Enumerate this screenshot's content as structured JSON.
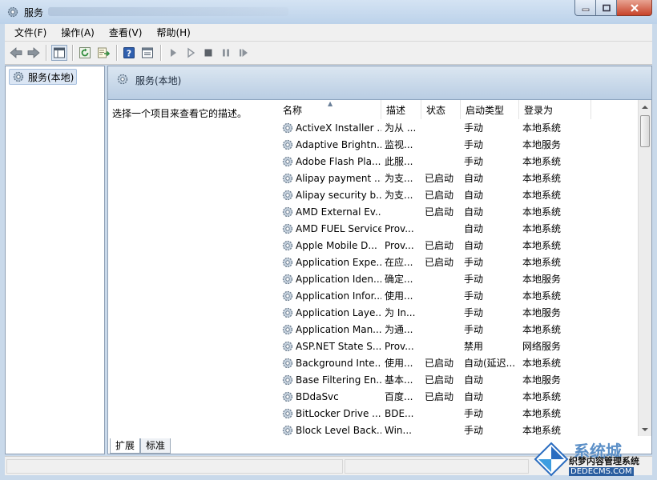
{
  "window": {
    "title": "服务"
  },
  "menu": [
    {
      "label": "文件(F)"
    },
    {
      "label": "操作(A)"
    },
    {
      "label": "查看(V)"
    },
    {
      "label": "帮助(H)"
    }
  ],
  "toolbar_icons": [
    "back-arrow-icon",
    "forward-arrow-icon",
    "show-hide-tree-icon",
    "refresh-icon",
    "export-list-icon",
    "help-icon",
    "properties-icon",
    "start-service-icon",
    "start-service-alt-icon",
    "stop-service-icon",
    "pause-service-icon",
    "restart-service-icon"
  ],
  "tree": {
    "root_label": "服务(本地)"
  },
  "right": {
    "header_title": "服务(本地)",
    "description": "选择一个项目来查看它的描述。"
  },
  "table": {
    "columns": [
      "名称",
      "描述",
      "状态",
      "启动类型",
      "登录为"
    ],
    "rows": [
      {
        "name": "ActiveX Installer ...",
        "desc": "为从 ...",
        "status": "",
        "start": "手动",
        "logon": "本地系统"
      },
      {
        "name": "Adaptive Brightn...",
        "desc": "监视...",
        "status": "",
        "start": "手动",
        "logon": "本地服务"
      },
      {
        "name": "Adobe Flash Pla...",
        "desc": "此服...",
        "status": "",
        "start": "手动",
        "logon": "本地系统"
      },
      {
        "name": "Alipay payment ...",
        "desc": "为支...",
        "status": "已启动",
        "start": "自动",
        "logon": "本地系统"
      },
      {
        "name": "Alipay security b...",
        "desc": "为支...",
        "status": "已启动",
        "start": "自动",
        "logon": "本地系统"
      },
      {
        "name": "AMD External Ev...",
        "desc": "",
        "status": "已启动",
        "start": "自动",
        "logon": "本地系统"
      },
      {
        "name": "AMD FUEL Service",
        "desc": "Prov...",
        "status": "",
        "start": "自动",
        "logon": "本地系统"
      },
      {
        "name": "Apple Mobile D...",
        "desc": "Prov...",
        "status": "已启动",
        "start": "自动",
        "logon": "本地系统"
      },
      {
        "name": "Application Expe...",
        "desc": "在应...",
        "status": "已启动",
        "start": "手动",
        "logon": "本地系统"
      },
      {
        "name": "Application Iden...",
        "desc": "确定...",
        "status": "",
        "start": "手动",
        "logon": "本地服务"
      },
      {
        "name": "Application Infor...",
        "desc": "使用...",
        "status": "",
        "start": "手动",
        "logon": "本地系统"
      },
      {
        "name": "Application Laye...",
        "desc": "为 In...",
        "status": "",
        "start": "手动",
        "logon": "本地服务"
      },
      {
        "name": "Application Man...",
        "desc": "为通...",
        "status": "",
        "start": "手动",
        "logon": "本地系统"
      },
      {
        "name": "ASP.NET State S...",
        "desc": "Prov...",
        "status": "",
        "start": "禁用",
        "logon": "网络服务"
      },
      {
        "name": "Background Inte...",
        "desc": "使用...",
        "status": "已启动",
        "start": "自动(延迟...",
        "logon": "本地系统"
      },
      {
        "name": "Base Filtering En...",
        "desc": "基本...",
        "status": "已启动",
        "start": "自动",
        "logon": "本地服务"
      },
      {
        "name": "BDdaSvc",
        "desc": "百度...",
        "status": "已启动",
        "start": "自动",
        "logon": "本地系统"
      },
      {
        "name": "BitLocker Drive ...",
        "desc": "BDE...",
        "status": "",
        "start": "手动",
        "logon": "本地系统"
      },
      {
        "name": "Block Level Back...",
        "desc": "Win...",
        "status": "",
        "start": "手动",
        "logon": "本地系统"
      }
    ]
  },
  "tabs": [
    {
      "label": "扩展"
    },
    {
      "label": "标准"
    }
  ],
  "watermark": {
    "top": "系统城",
    "mid": "织梦内容管理系统",
    "bot": "DEDECMS.COM"
  },
  "colors": {
    "accent": "#3a6ea5",
    "header_gradient": "#b9cde3",
    "close_button": "#c7432a"
  }
}
